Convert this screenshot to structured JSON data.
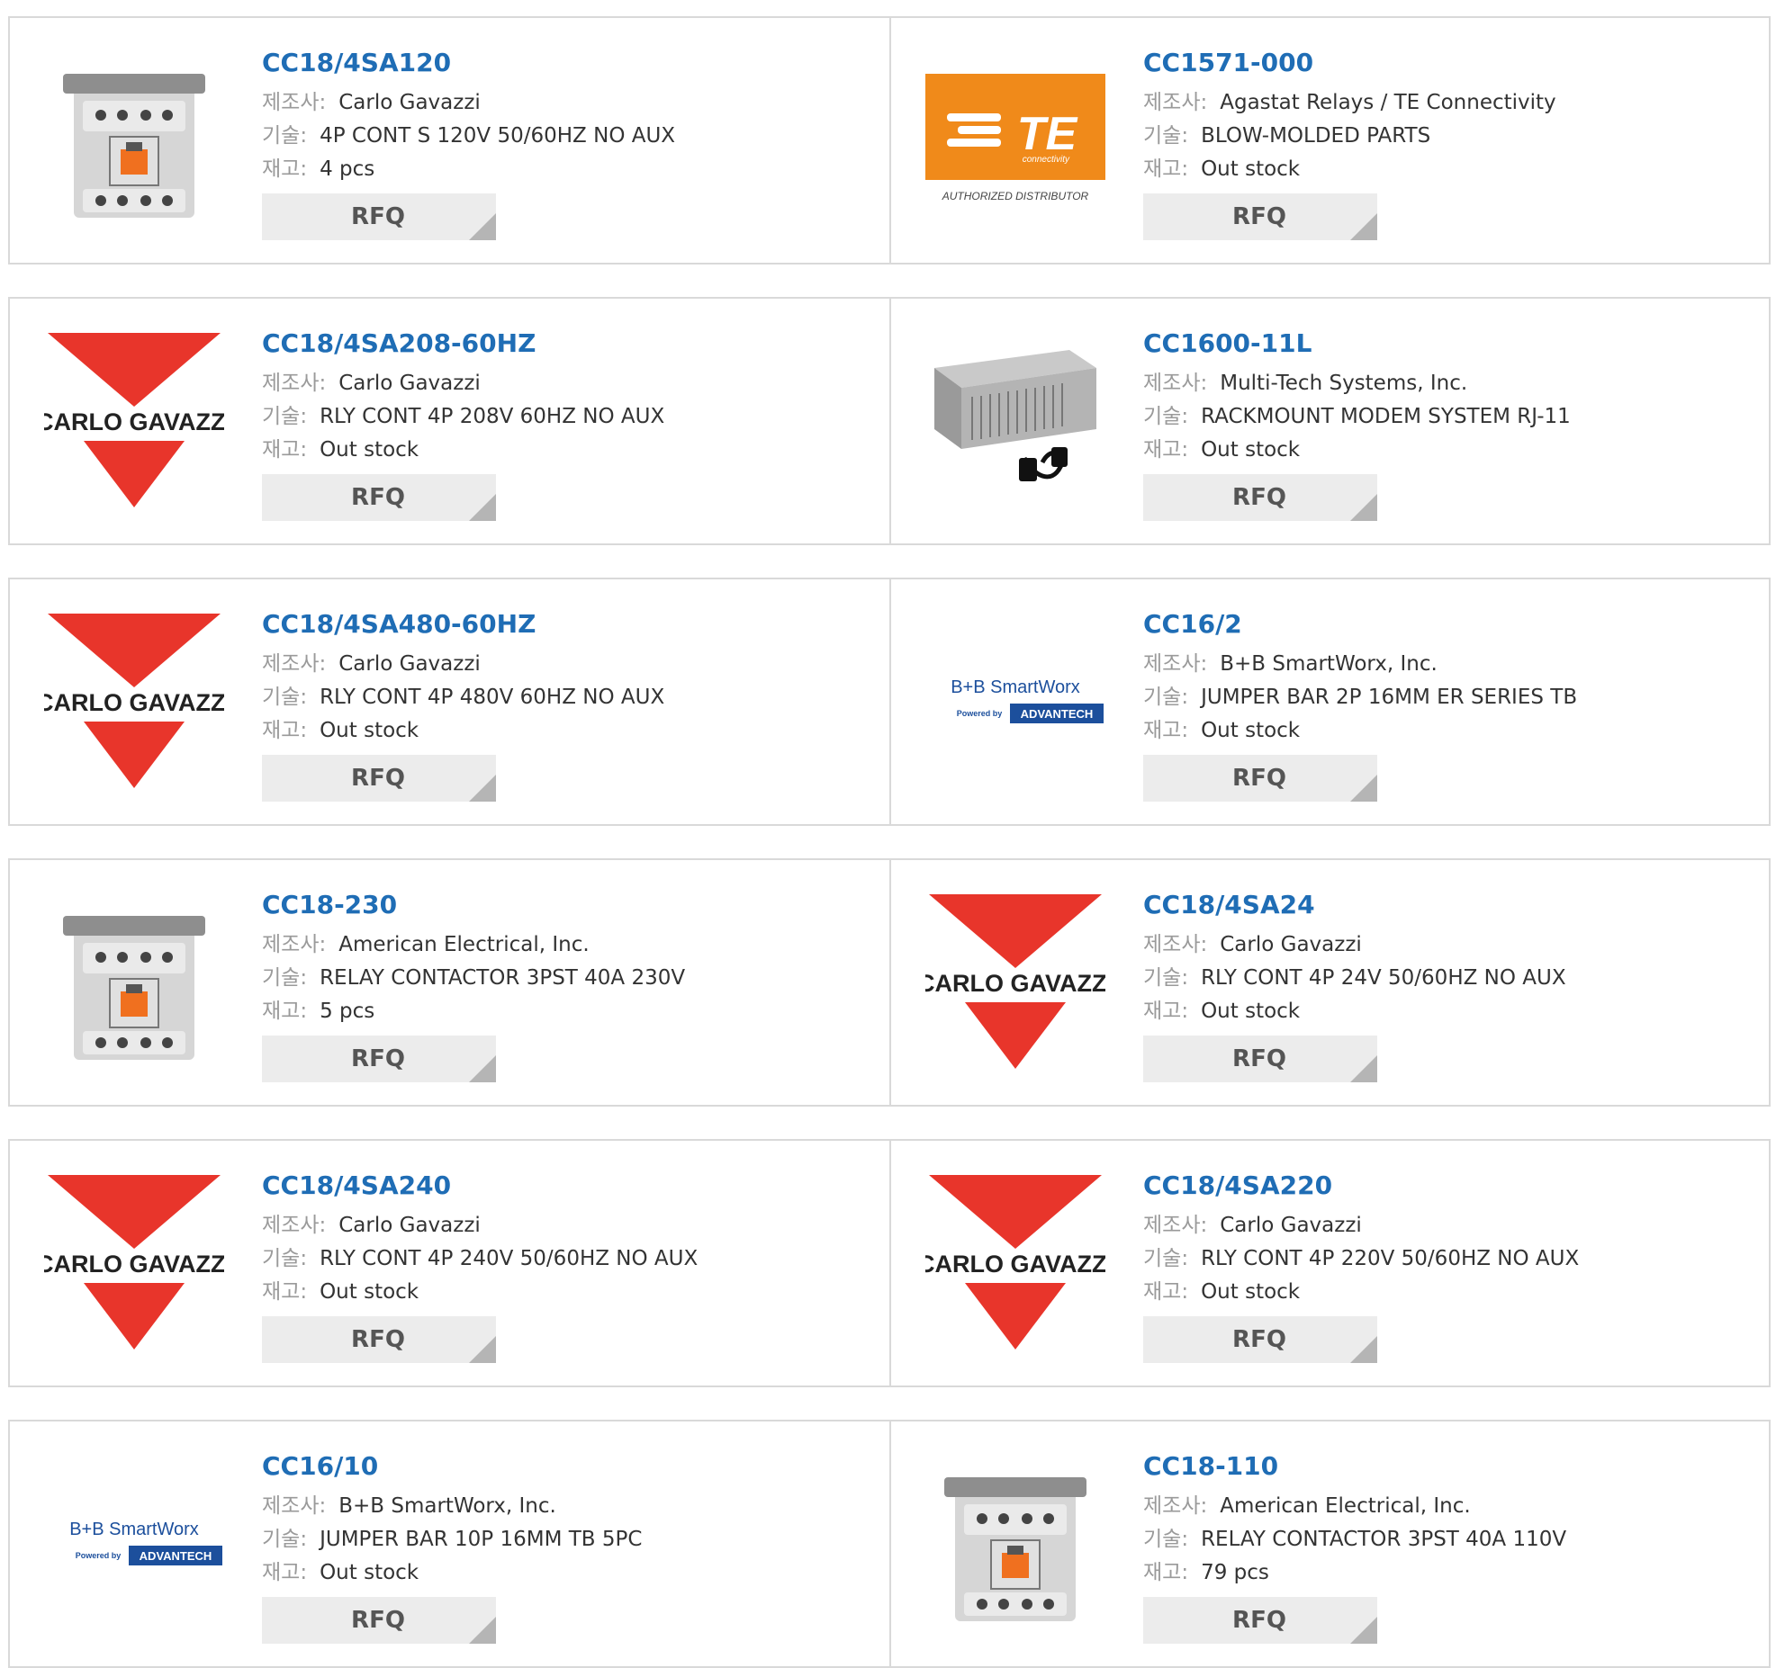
{
  "labels": {
    "manufacturer": "제조사:",
    "description": "기술:",
    "stock": "재고:",
    "rfq": "RFQ"
  },
  "logos": {
    "carlo_gavazzi": "CARLO GAVAZZI",
    "te_main": "TE",
    "te_sub": "connectivity",
    "te_footer": "AUTHORIZED DISTRIBUTOR",
    "bb_main": "B+B SmartWorx",
    "bb_powered": "Powered by",
    "bb_advantech": "ADVANTECH"
  },
  "colors": {
    "part_link": "#1f6db5",
    "carlo_red": "#e8352b",
    "te_orange": "#f08a1a",
    "advantech_blue": "#1c4f9c"
  },
  "products": [
    {
      "pn": "CC18/4SA120",
      "manufacturer": "Carlo Gavazzi",
      "description": "4P CONT S 120V 50/60HZ NO AUX",
      "stock": "4 pcs",
      "image": "contactor-photo"
    },
    {
      "pn": "CC1571-000",
      "manufacturer": "Agastat Relays / TE Connectivity",
      "description": "BLOW-MOLDED PARTS",
      "stock": "Out stock",
      "image": "te-logo"
    },
    {
      "pn": "CC18/4SA208-60HZ",
      "manufacturer": "Carlo Gavazzi",
      "description": "RLY CONT 4P 208V 60HZ NO AUX",
      "stock": "Out stock",
      "image": "carlo-gavazzi-logo"
    },
    {
      "pn": "CC1600-11L",
      "manufacturer": "Multi-Tech Systems, Inc.",
      "description": "RACKMOUNT MODEM SYSTEM RJ-11",
      "stock": "Out stock",
      "image": "rackmount-photo"
    },
    {
      "pn": "CC18/4SA480-60HZ",
      "manufacturer": "Carlo Gavazzi",
      "description": "RLY CONT 4P 480V 60HZ NO AUX",
      "stock": "Out stock",
      "image": "carlo-gavazzi-logo"
    },
    {
      "pn": "CC16/2",
      "manufacturer": "B+B SmartWorx, Inc.",
      "description": "JUMPER BAR 2P 16MM ER SERIES TB",
      "stock": "Out stock",
      "image": "bb-smartworx-logo"
    },
    {
      "pn": "CC18-230",
      "manufacturer": "American Electrical, Inc.",
      "description": "RELAY CONTACTOR 3PST 40A 230V",
      "stock": "5 pcs",
      "image": "contactor-photo"
    },
    {
      "pn": "CC18/4SA24",
      "manufacturer": "Carlo Gavazzi",
      "description": "RLY CONT 4P 24V 50/60HZ NO AUX",
      "stock": "Out stock",
      "image": "carlo-gavazzi-logo"
    },
    {
      "pn": "CC18/4SA240",
      "manufacturer": "Carlo Gavazzi",
      "description": "RLY CONT 4P 240V 50/60HZ NO AUX",
      "stock": "Out stock",
      "image": "carlo-gavazzi-logo"
    },
    {
      "pn": "CC18/4SA220",
      "manufacturer": "Carlo Gavazzi",
      "description": "RLY CONT 4P 220V 50/60HZ NO AUX",
      "stock": "Out stock",
      "image": "carlo-gavazzi-logo"
    },
    {
      "pn": "CC16/10",
      "manufacturer": "B+B SmartWorx, Inc.",
      "description": "JUMPER BAR 10P 16MM TB 5PC",
      "stock": "Out stock",
      "image": "bb-smartworx-logo"
    },
    {
      "pn": "CC18-110",
      "manufacturer": "American Electrical, Inc.",
      "description": "RELAY CONTACTOR 3PST 40A 110V",
      "stock": "79 pcs",
      "image": "contactor-photo"
    }
  ]
}
